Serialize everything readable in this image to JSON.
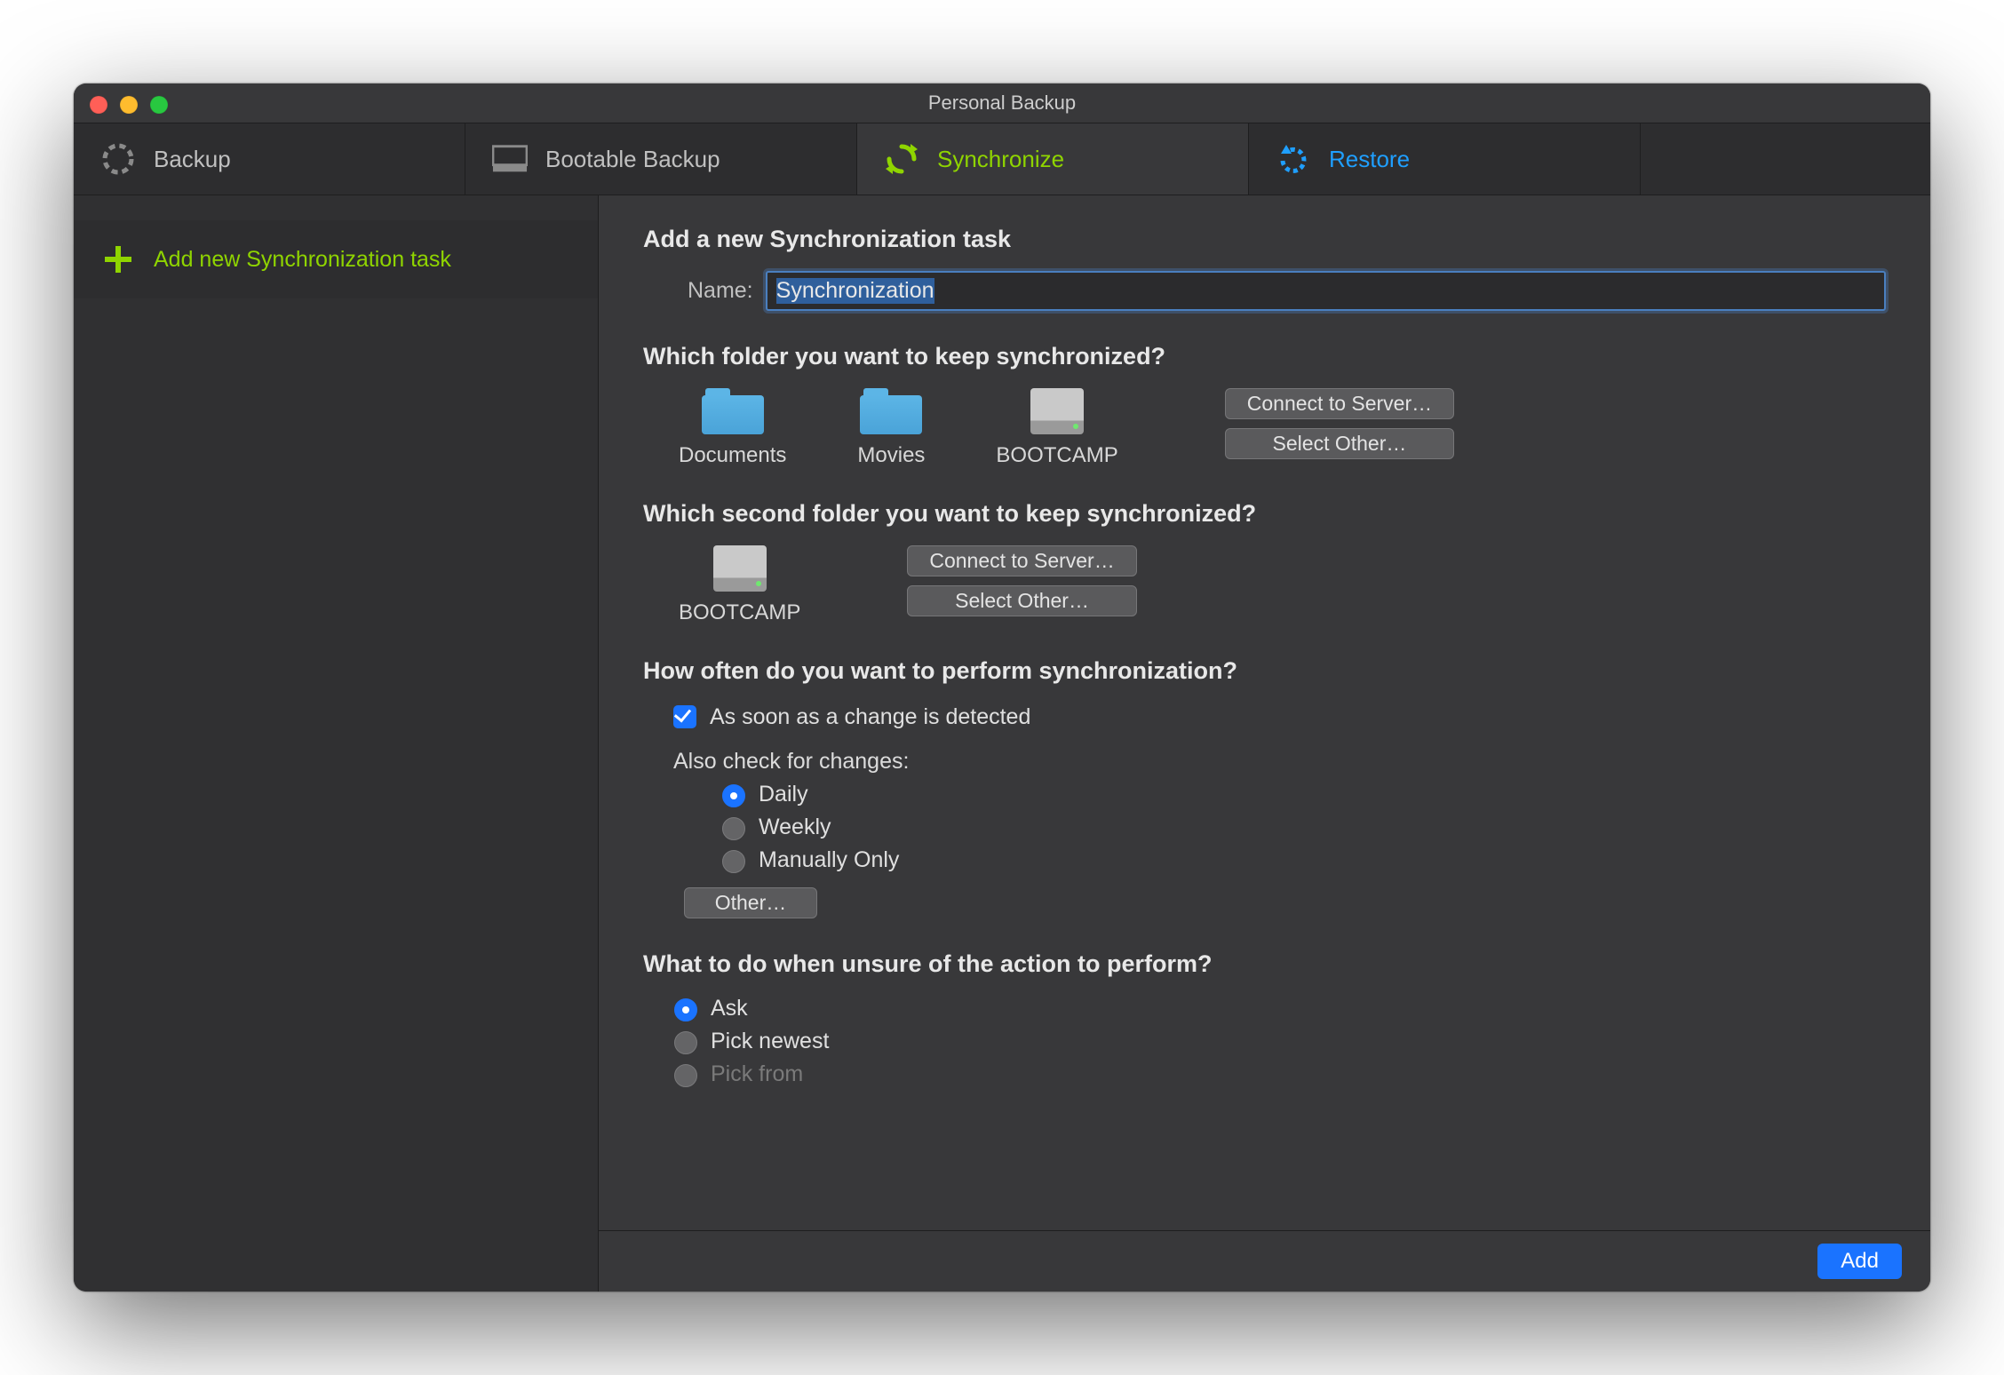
{
  "window": {
    "title": "Personal Backup"
  },
  "tabs": {
    "backup": "Backup",
    "bootable": "Bootable Backup",
    "synchronize": "Synchronize",
    "restore": "Restore"
  },
  "sidebar": {
    "add_new_task": "Add new Synchronization task"
  },
  "main": {
    "heading": "Add a new Synchronization task",
    "name_label": "Name:",
    "name_value": "Synchronization",
    "q_folder1": "Which folder you want to keep synchronized?",
    "q_folder2": "Which second folder you want to keep synchronized?",
    "sources": {
      "documents": "Documents",
      "movies": "Movies",
      "bootcamp": "BOOTCAMP"
    },
    "connect_to_server": "Connect to Server…",
    "select_other": "Select Other…",
    "q_howoften": "How often do you want to perform synchronization?",
    "opt_onchange": "As soon as a change is detected",
    "also_check": "Also check for changes:",
    "opts": {
      "daily": "Daily",
      "weekly": "Weekly",
      "manually": "Manually Only",
      "other_btn": "Other…"
    },
    "q_unsure": "What to do when unsure of the action to perform?",
    "unsure": {
      "ask": "Ask",
      "pick_newest": "Pick newest",
      "pick_from": "Pick from"
    }
  },
  "footer": {
    "add": "Add"
  }
}
